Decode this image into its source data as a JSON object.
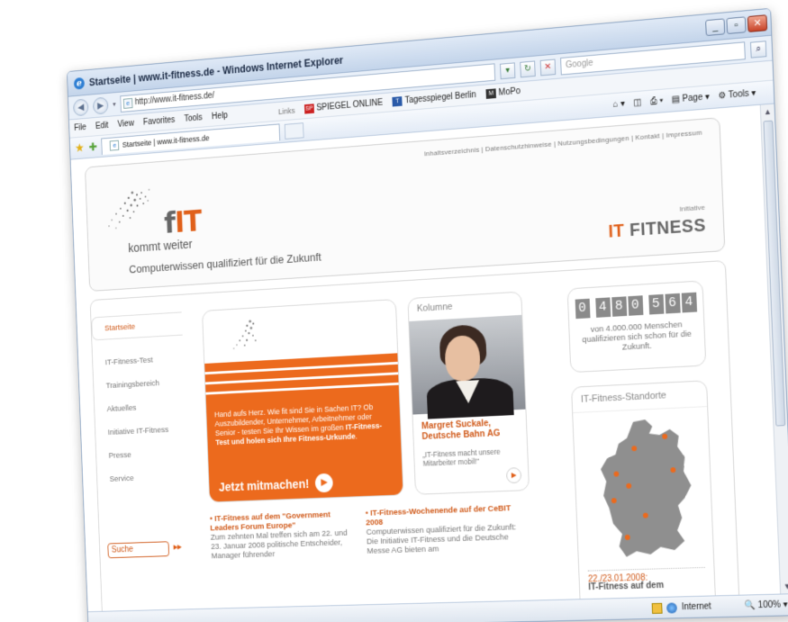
{
  "window": {
    "title": "Startseite | www.it-fitness.de - Windows Internet Explorer",
    "controls": {
      "minimize": "_",
      "maximize": "▫",
      "close": "✕"
    }
  },
  "address": {
    "url": "http://www.it-fitness.de/",
    "search_placeholder": "Google"
  },
  "menu": {
    "items": [
      "File",
      "Edit",
      "View",
      "Favorites",
      "Tools",
      "Help"
    ],
    "links_label": "Links",
    "links": [
      {
        "label": "SPIEGEL ONLINE",
        "icon": "spiegel-icon"
      },
      {
        "label": "Tagesspiegel Berlin",
        "icon": "tagesspiegel-icon"
      },
      {
        "label": "MoPo",
        "icon": "mopo-icon"
      }
    ]
  },
  "command": {
    "tab_label": "Startseite | www.it-fitness.de",
    "page_label": "Page",
    "tools_label": "Tools"
  },
  "status": {
    "zone": "Internet",
    "zoom": "100%"
  },
  "site": {
    "top_links": "Inhaltsverzeichnis | Datenschutzhinweise | Nutzungsbedingungen | Kontakt | Impressum",
    "logo_f": "f",
    "logo_it": "IT",
    "kommt_weiter": "kommt weiter",
    "tagline": "Computerwissen qualifiziert für die Zukunft",
    "initiative_label": "Initiative",
    "brand_it": "IT",
    "brand_fitness": "FITNESS",
    "nav": [
      "Startseite",
      "IT-Fitness-Test",
      "Trainingsbereich",
      "Aktuelles",
      "Initiative IT-Fitness",
      "Presse",
      "Service"
    ],
    "search_label": "Suche",
    "search_go": "▸▸",
    "promo": {
      "text_plain": "Hand aufs Herz. Wie fit sind Sie in Sachen IT? Ob Auszubildender, Unternehmer, Arbeitnehmer oder Senior - testen Sie Ihr Wissen im großen ",
      "text_bold": "IT-Fitness-Test und holen sich Ihre Fitness-Urkunde",
      "text_end": ".",
      "cta": "Jetzt mitmachen!"
    },
    "kolumne": {
      "head": "Kolumne",
      "name": "Margret Suckale, Deutsche Bahn AG",
      "quote": "„IT-Fitness macht unsere Mitarbeiter mobil!“"
    },
    "counter": {
      "digits": [
        "0",
        "4",
        "8",
        "0",
        "5",
        "6",
        "4"
      ],
      "text": "von 4.000.000 Menschen qualifizieren sich schon für die Zukunft."
    },
    "standorte": {
      "head": "IT-Fitness-Standorte",
      "date": "22./23.01.2008:",
      "event": "IT-Fitness auf dem"
    },
    "news": [
      {
        "title": "• IT-Fitness auf dem \"Government Leaders Forum Europe\"",
        "body": "Zum zehnten Mal treffen sich am 22. und 23. Januar 2008 politische Entscheider, Manager führender"
      },
      {
        "title": "• IT-Fitness-Wochenende auf der CeBIT 2008",
        "body": "Computerwissen qualifiziert für die Zukunft: Die Initiative IT-Fitness und die Deutsche Messe AG bieten am"
      }
    ]
  },
  "colors": {
    "brand_orange": "#ec6a1d",
    "brand_grey": "#666666",
    "ie_frame": "#c3d4ea"
  }
}
